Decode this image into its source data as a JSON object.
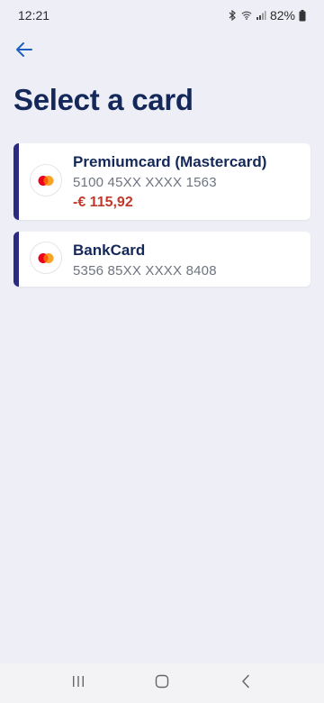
{
  "status_bar": {
    "time": "12:21",
    "battery": "82%",
    "icons": [
      "bluetooth-icon",
      "wifi-icon",
      "signal-icon",
      "battery-icon"
    ]
  },
  "header": {
    "back_icon": "arrow-left-icon",
    "title": "Select a card"
  },
  "colors": {
    "title": "#14285a",
    "accent_bar": "#2b2a80",
    "negative_amount": "#c0392b",
    "back_arrow": "#1e5fc0"
  },
  "cards": [
    {
      "name": "Premiumcard (Mastercard)",
      "number": "5100 45XX XXXX 1563",
      "balance": "-€ 115,92",
      "logo_icon": "mastercard-icon"
    },
    {
      "name": "BankCard",
      "number": "5356 85XX XXXX 8408",
      "logo_icon": "mastercard-icon"
    }
  ],
  "nav_bar": {
    "icons": [
      "recent-apps-icon",
      "home-icon",
      "back-nav-icon"
    ]
  }
}
